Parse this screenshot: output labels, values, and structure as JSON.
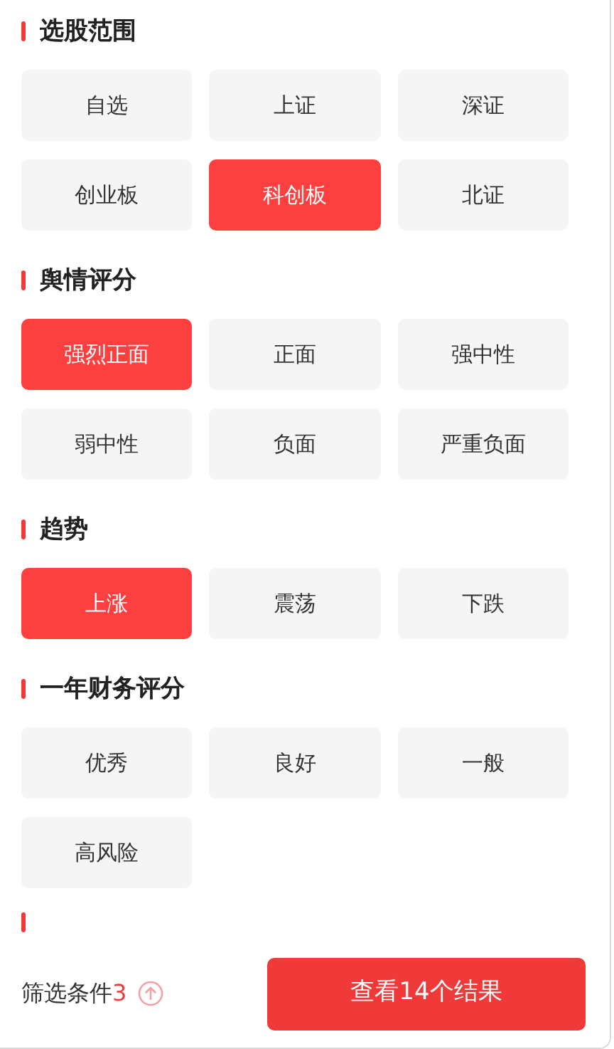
{
  "sections": [
    {
      "title": "选股范围",
      "options": [
        {
          "label": "自选",
          "selected": false
        },
        {
          "label": "上证",
          "selected": false
        },
        {
          "label": "深证",
          "selected": false
        },
        {
          "label": "创业板",
          "selected": false
        },
        {
          "label": "科创板",
          "selected": true
        },
        {
          "label": "北证",
          "selected": false
        }
      ]
    },
    {
      "title": "舆情评分",
      "options": [
        {
          "label": "强烈正面",
          "selected": true
        },
        {
          "label": "正面",
          "selected": false
        },
        {
          "label": "强中性",
          "selected": false
        },
        {
          "label": "弱中性",
          "selected": false
        },
        {
          "label": "负面",
          "selected": false
        },
        {
          "label": "严重负面",
          "selected": false
        }
      ]
    },
    {
      "title": "趋势",
      "options": [
        {
          "label": "上涨",
          "selected": true
        },
        {
          "label": "震荡",
          "selected": false
        },
        {
          "label": "下跌",
          "selected": false
        }
      ]
    },
    {
      "title": "一年财务评分",
      "options": [
        {
          "label": "优秀",
          "selected": false
        },
        {
          "label": "良好",
          "selected": false
        },
        {
          "label": "一般",
          "selected": false
        },
        {
          "label": "高风险",
          "selected": false
        }
      ]
    }
  ],
  "next_section_peek": true,
  "footer": {
    "label": "筛选条件",
    "count": "3",
    "button": "查看14个结果"
  }
}
